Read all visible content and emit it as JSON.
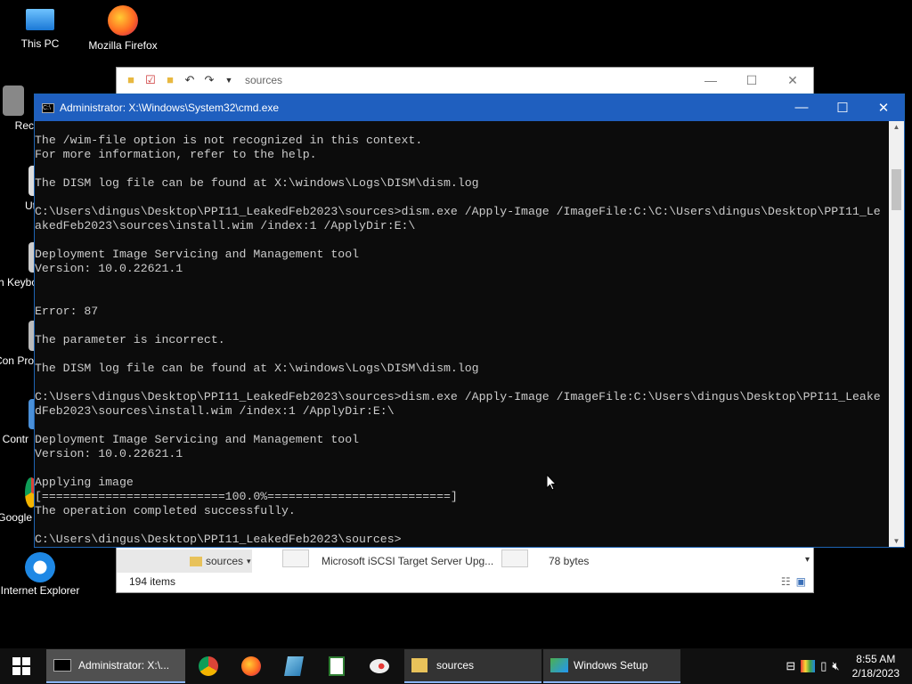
{
  "desktop": {
    "icons": [
      {
        "label": "This PC",
        "icon": "this-pc-icon"
      },
      {
        "label": "Mozilla Firefox",
        "icon": "firefox-icon"
      },
      {
        "label": "Recy",
        "icon": "recycle-bin-icon"
      },
      {
        "label": "Ut",
        "icon": "utility-icon"
      },
      {
        "label": "Ch Keybo",
        "icon": "keyboard-icon"
      },
      {
        "label": "Con Pro",
        "icon": "control-icon"
      },
      {
        "label": "Contr",
        "icon": "control-panel-icon"
      },
      {
        "label": "Google",
        "icon": "chrome-icon"
      },
      {
        "label": "Internet Explorer",
        "icon": "ie-icon"
      }
    ]
  },
  "explorer": {
    "address": "sources",
    "row_folder": "sources",
    "row_item": "Microsoft iSCSI Target Server Upg...",
    "row_size": "78 bytes",
    "status": "194 items"
  },
  "cmd": {
    "title": "Administrator: X:\\Windows\\System32\\cmd.exe",
    "lines": [
      "The /wim-file option is not recognized in this context.",
      "For more information, refer to the help.",
      "",
      "The DISM log file can be found at X:\\windows\\Logs\\DISM\\dism.log",
      "",
      "C:\\Users\\dingus\\Desktop\\PPI11_LeakedFeb2023\\sources>dism.exe /Apply-Image /ImageFile:C:\\C:\\Users\\dingus\\Desktop\\PPI11_Le",
      "akedFeb2023\\sources\\install.wim /index:1 /ApplyDir:E:\\",
      "",
      "Deployment Image Servicing and Management tool",
      "Version: 10.0.22621.1",
      "",
      "",
      "Error: 87",
      "",
      "The parameter is incorrect.",
      "",
      "The DISM log file can be found at X:\\windows\\Logs\\DISM\\dism.log",
      "",
      "C:\\Users\\dingus\\Desktop\\PPI11_LeakedFeb2023\\sources>dism.exe /Apply-Image /ImageFile:C:\\Users\\dingus\\Desktop\\PPI11_Leake",
      "dFeb2023\\sources\\install.wim /index:1 /ApplyDir:E:\\",
      "",
      "Deployment Image Servicing and Management tool",
      "Version: 10.0.22621.1",
      "",
      "Applying image",
      "[==========================100.0%==========================]",
      "The operation completed successfully.",
      "",
      "C:\\Users\\dingus\\Desktop\\PPI11_LeakedFeb2023\\sources>"
    ]
  },
  "taskbar": {
    "tasks": [
      {
        "label": "Administrator: X:\\...",
        "icon": "cmd-icon"
      },
      {
        "label": "sources",
        "icon": "folder-icon"
      },
      {
        "label": "Windows Setup",
        "icon": "setup-icon"
      }
    ],
    "pinned": [
      "chrome-icon",
      "firefox-icon",
      "notepad-icon",
      "spreadsheet-icon",
      "paint-icon"
    ],
    "time": "8:55 AM",
    "date": "2/18/2023"
  },
  "colors": {
    "cmd_title_bar": "#1f5fbf",
    "cmd_text": "#cccccc",
    "taskbar": "#101010"
  }
}
